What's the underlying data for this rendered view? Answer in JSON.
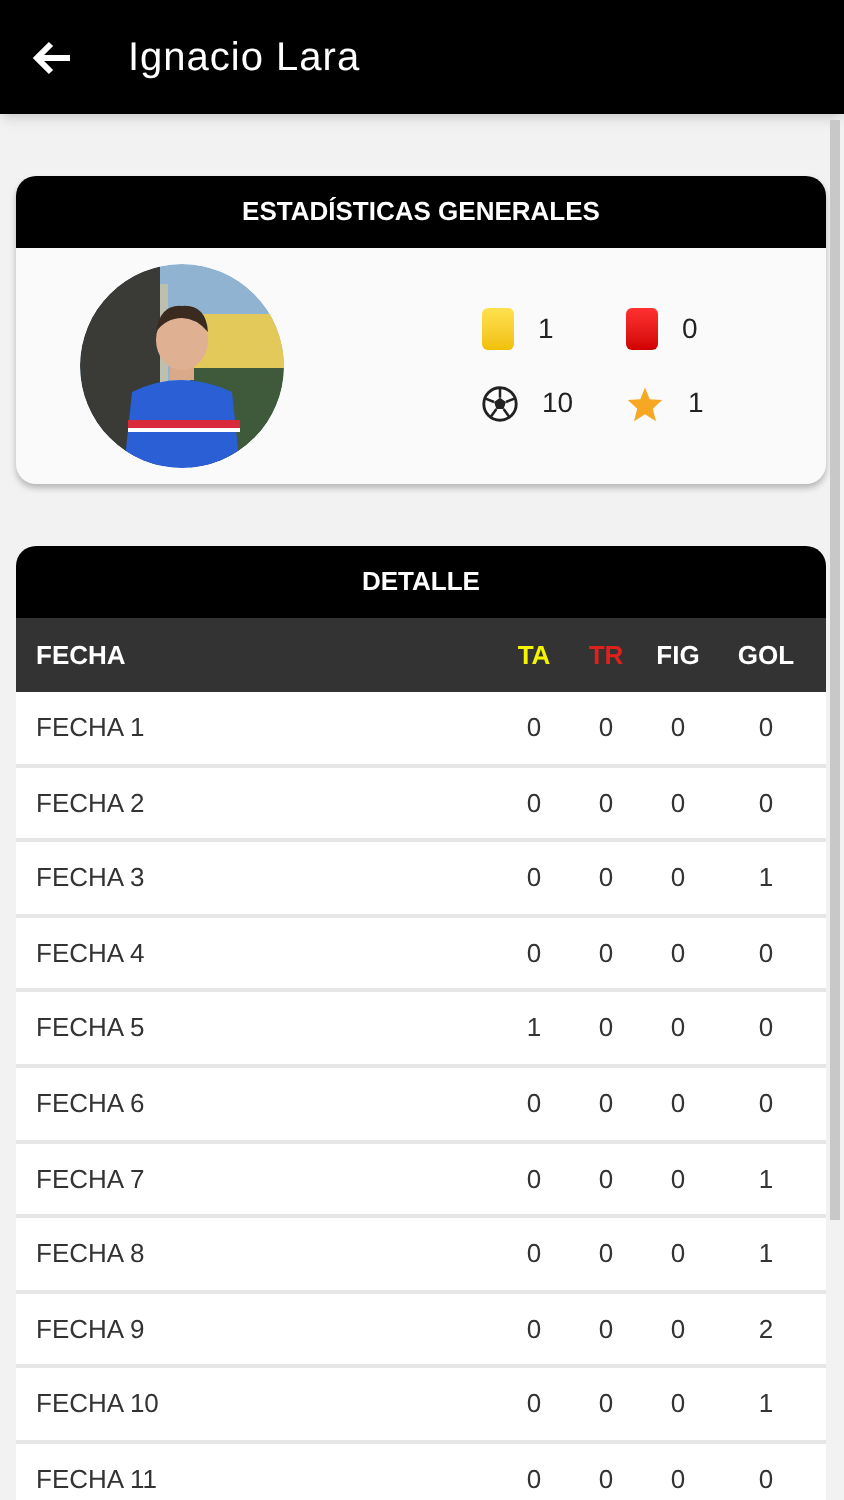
{
  "app_bar": {
    "title": "Ignacio Lara"
  },
  "general_stats": {
    "title": "ESTADÍSTICAS GENERALES",
    "stats": [
      {
        "kind": "yellow_card",
        "value": "1"
      },
      {
        "kind": "red_card",
        "value": "0"
      },
      {
        "kind": "goals",
        "value": "10"
      },
      {
        "kind": "star",
        "value": "1"
      }
    ]
  },
  "detail": {
    "title": "DETALLE",
    "columns": [
      {
        "label": "FECHA",
        "color": "#ffffff"
      },
      {
        "label": "TA",
        "color": "#f5f500"
      },
      {
        "label": "TR",
        "color": "#e0201c"
      },
      {
        "label": "FIG",
        "color": "#ffffff"
      },
      {
        "label": "GOL",
        "color": "#ffffff"
      }
    ],
    "rows": [
      [
        "FECHA 1",
        "0",
        "0",
        "0",
        "0"
      ],
      [
        "FECHA 2",
        "0",
        "0",
        "0",
        "0"
      ],
      [
        "FECHA 3",
        "0",
        "0",
        "0",
        "1"
      ],
      [
        "FECHA 4",
        "0",
        "0",
        "0",
        "0"
      ],
      [
        "FECHA 5",
        "1",
        "0",
        "0",
        "0"
      ],
      [
        "FECHA 6",
        "0",
        "0",
        "0",
        "0"
      ],
      [
        "FECHA 7",
        "0",
        "0",
        "0",
        "1"
      ],
      [
        "FECHA 8",
        "0",
        "0",
        "0",
        "1"
      ],
      [
        "FECHA 9",
        "0",
        "0",
        "0",
        "2"
      ],
      [
        "FECHA 10",
        "0",
        "0",
        "0",
        "1"
      ],
      [
        "FECHA 11",
        "0",
        "0",
        "0",
        "0"
      ]
    ]
  }
}
